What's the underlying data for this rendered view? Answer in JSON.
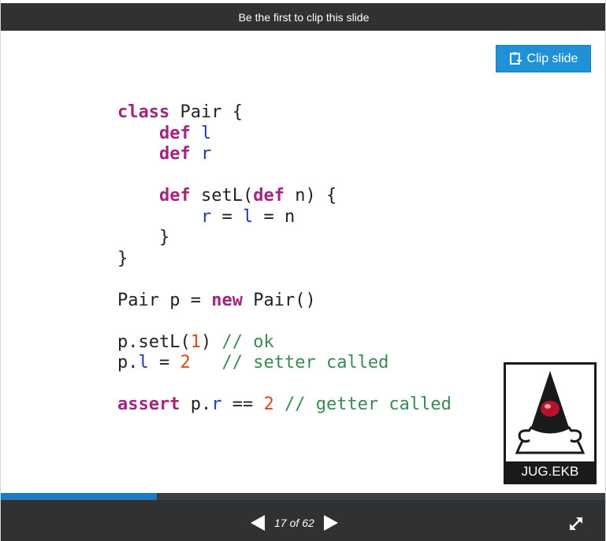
{
  "top_bar": {
    "text": "Be the first to clip this slide"
  },
  "clip_button": {
    "label": "Clip slide"
  },
  "code_lines": [
    [
      {
        "t": "class",
        "c": "kw"
      },
      {
        "t": " Pair {"
      }
    ],
    [
      {
        "t": "    "
      },
      {
        "t": "def",
        "c": "kw"
      },
      {
        "t": " "
      },
      {
        "t": "l",
        "c": "var"
      }
    ],
    [
      {
        "t": "    "
      },
      {
        "t": "def",
        "c": "kw"
      },
      {
        "t": " "
      },
      {
        "t": "r",
        "c": "var"
      }
    ],
    [],
    [
      {
        "t": "    "
      },
      {
        "t": "def",
        "c": "kw"
      },
      {
        "t": " setL("
      },
      {
        "t": "def",
        "c": "kw"
      },
      {
        "t": " n) {"
      }
    ],
    [
      {
        "t": "        "
      },
      {
        "t": "r",
        "c": "var"
      },
      {
        "t": " = "
      },
      {
        "t": "l",
        "c": "var"
      },
      {
        "t": " = n"
      }
    ],
    [
      {
        "t": "    }"
      }
    ],
    [
      {
        "t": "}"
      }
    ],
    [],
    [
      {
        "t": "Pair p = "
      },
      {
        "t": "new",
        "c": "kw"
      },
      {
        "t": " Pair()"
      }
    ],
    [],
    [
      {
        "t": "p.setL("
      },
      {
        "t": "1",
        "c": "num"
      },
      {
        "t": ") "
      },
      {
        "t": "// ok",
        "c": "cmt"
      }
    ],
    [
      {
        "t": "p."
      },
      {
        "t": "l",
        "c": "var"
      },
      {
        "t": " = "
      },
      {
        "t": "2",
        "c": "num"
      },
      {
        "t": "   "
      },
      {
        "t": "// setter called",
        "c": "cmt"
      }
    ],
    [],
    [
      {
        "t": "assert",
        "c": "kw"
      },
      {
        "t": " p."
      },
      {
        "t": "r",
        "c": "var"
      },
      {
        "t": " == "
      },
      {
        "t": "2",
        "c": "num"
      },
      {
        "t": " "
      },
      {
        "t": "// getter called",
        "c": "cmt"
      }
    ]
  ],
  "logo": {
    "text": "JUG.EKB",
    "icon": "duke-mascot-icon"
  },
  "progress": {
    "current": 17,
    "total": 62,
    "fraction": 0.258
  },
  "pager": {
    "current": "17",
    "separator": "of",
    "total": "62"
  },
  "colors": {
    "accent": "#1f91d6",
    "bar": "#2f3133",
    "keyword": "#a4247f",
    "variable": "#1f3bb0",
    "number": "#d94a17",
    "comment": "#3a8a54"
  }
}
